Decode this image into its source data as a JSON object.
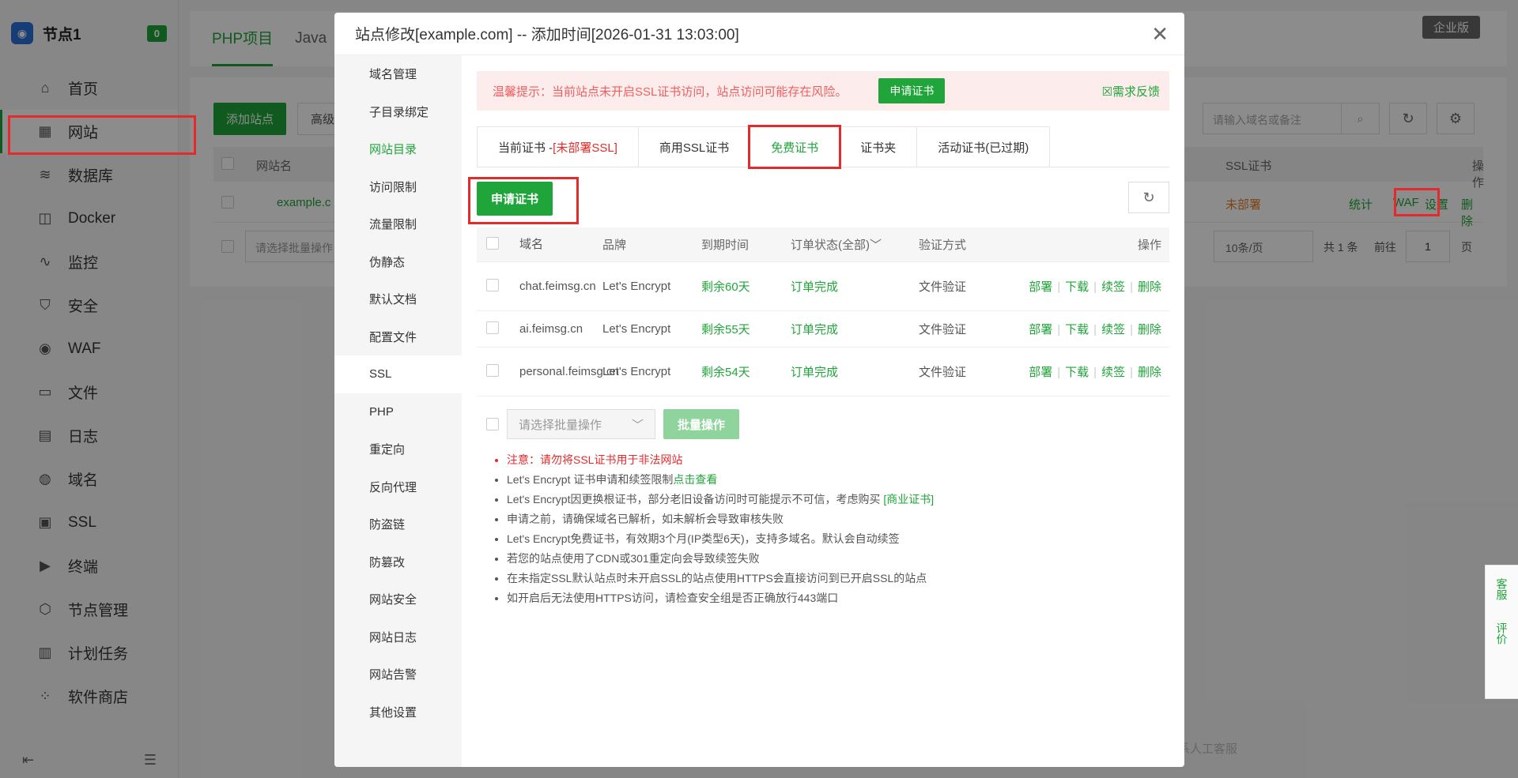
{
  "sidebar": {
    "node_title": "节点1",
    "node_badge": "0",
    "items": [
      {
        "label": "首页",
        "icon": "home-icon",
        "glyph": "⌂"
      },
      {
        "label": "网站",
        "icon": "website-icon",
        "glyph": "▦"
      },
      {
        "label": "数据库",
        "icon": "database-icon",
        "glyph": "≋"
      },
      {
        "label": "Docker",
        "icon": "docker-icon",
        "glyph": "◫"
      },
      {
        "label": "监控",
        "icon": "monitor-icon",
        "glyph": "∿"
      },
      {
        "label": "安全",
        "icon": "shield-icon",
        "glyph": "⛉"
      },
      {
        "label": "WAF",
        "icon": "waf-icon",
        "glyph": "◉"
      },
      {
        "label": "文件",
        "icon": "folder-icon",
        "glyph": "▭"
      },
      {
        "label": "日志",
        "icon": "log-icon",
        "glyph": "▤"
      },
      {
        "label": "域名",
        "icon": "globe-icon",
        "glyph": "◍"
      },
      {
        "label": "SSL",
        "icon": "ssl-icon",
        "glyph": "▣"
      },
      {
        "label": "终端",
        "icon": "terminal-icon",
        "glyph": "▶"
      },
      {
        "label": "节点管理",
        "icon": "cube-icon",
        "glyph": "⬡"
      },
      {
        "label": "计划任务",
        "icon": "calendar-icon",
        "glyph": "▥"
      },
      {
        "label": "软件商店",
        "icon": "apps-icon",
        "glyph": "⁘"
      }
    ]
  },
  "main": {
    "tabs": [
      "PHP项目",
      "Java"
    ],
    "enterprise_badge": "企业版",
    "add_site": "添加站点",
    "advanced": "高级设",
    "search_placeholder": "请输入域名或备注",
    "table_headers": {
      "site_name": "网站名",
      "ssl": "SSL证书",
      "ops": "操作"
    },
    "row": {
      "site": "example.c",
      "ssl_status": "未部署",
      "op_stats": "统计",
      "op_waf": "WAF",
      "op_settings": "设置",
      "op_delete": "删除"
    },
    "batch_placeholder": "请选择批量操作",
    "page_size": "10条/页",
    "total": "共 1 条",
    "goto": "前往",
    "page": "1",
    "page_unit": "页",
    "footer": "系人工客服"
  },
  "modal": {
    "title": "站点修改[example.com] -- 添加时间[2026-01-31 13:03:00]",
    "side_items": [
      "域名管理",
      "子目录绑定",
      "网站目录",
      "访问限制",
      "流量限制",
      "伪静态",
      "默认文档",
      "配置文件",
      "SSL",
      "PHP",
      "重定向",
      "反向代理",
      "防盗链",
      "防篡改",
      "网站安全",
      "网站日志",
      "网站告警",
      "其他设置"
    ],
    "warning": "温馨提示：当前站点未开启SSL证书访问，站点访问可能存在风险。",
    "warning_btn": "申请证书",
    "feedback": "需求反馈",
    "cert_tabs": {
      "current": "当前证书 - ",
      "current_red": "[未部署SSL]",
      "commercial": "商用SSL证书",
      "free": "免费证书",
      "folder": "证书夹",
      "activity": "活动证书(已过期)"
    },
    "apply_btn": "申请证书",
    "table_headers": {
      "domain": "域名",
      "brand": "品牌",
      "expire": "到期时间",
      "status": "订单状态(全部)",
      "verify": "验证方式",
      "ops": "操作"
    },
    "rows": [
      {
        "domain": "chat.feimsg.cn",
        "brand": "Let's Encrypt",
        "expire": "剩余60天",
        "status": "订单完成",
        "verify": "文件验证"
      },
      {
        "domain": "ai.feimsg.cn",
        "brand": "Let's Encrypt",
        "expire": "剩余55天",
        "status": "订单完成",
        "verify": "文件验证"
      },
      {
        "domain": "personal.feimsg.cn",
        "brand": "Let's Encrypt",
        "expire": "剩余54天",
        "status": "订单完成",
        "verify": "文件验证"
      }
    ],
    "row_ops": [
      "部署",
      "下载",
      "续签",
      "删除"
    ],
    "batch_placeholder": "请选择批量操作",
    "batch_btn": "批量操作",
    "notes": {
      "n1": "注意：请勿将SSL证书用于非法网站",
      "n2": "Let's Encrypt 证书申请和续签限制",
      "n2_link": "点击查看",
      "n3": "Let's Encrypt因更换根证书，部分老旧设备访问时可能提示不可信，考虑购买 ",
      "n3_link": "[商业证书]",
      "n4": "申请之前，请确保域名已解析，如未解析会导致审核失败",
      "n5": "Let's Encrypt免费证书，有效期3个月(IP类型6天)，支持多域名。默认会自动续签",
      "n6": "若您的站点使用了CDN或301重定向会导致续签失败",
      "n7": "在未指定SSL默认站点时未开启SSL的站点使用HTTPS会直接访问到已开启SSL的站点",
      "n8": "如开启后无法使用HTTPS访问，请检查安全组是否正确放行443端口"
    }
  },
  "float_tab": {
    "service": "客服",
    "rate": "评价"
  },
  "colors": {
    "brand": "#20a53a",
    "danger": "#e32b2b"
  }
}
